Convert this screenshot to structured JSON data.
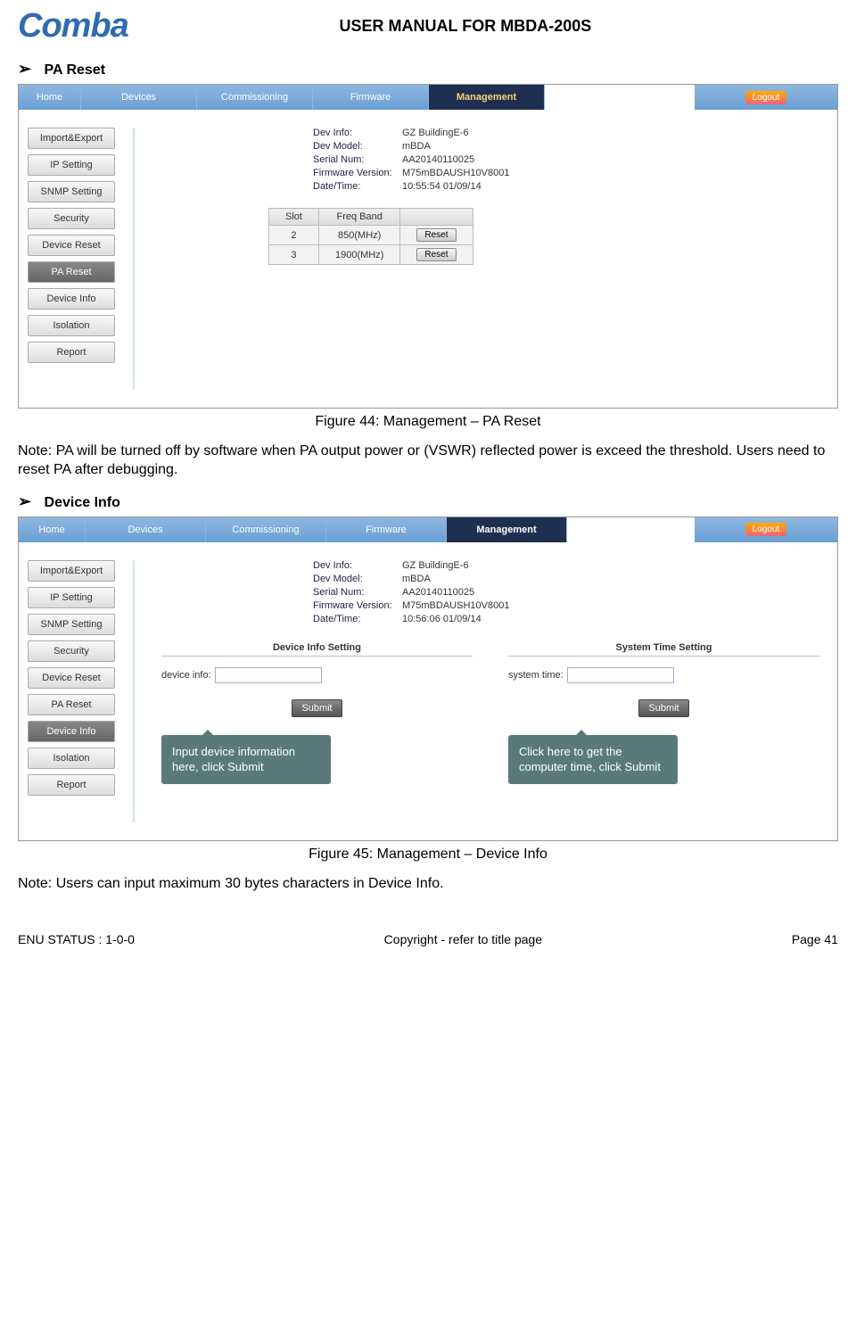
{
  "header": {
    "logo": "Comba",
    "title": "USER MANUAL FOR MBDA-200S"
  },
  "section1": {
    "title": "PA Reset"
  },
  "nav": {
    "items": [
      "Home",
      "Devices",
      "Commissioning",
      "Firmware",
      "Management"
    ],
    "logout": "Logout"
  },
  "sidebar": {
    "items": [
      "Import&Export",
      "IP Setting",
      "SNMP Setting",
      "Security",
      "Device Reset",
      "PA Reset",
      "Device Info",
      "Isolation",
      "Report"
    ]
  },
  "devinfo": {
    "rows": [
      {
        "label": "Dev Info:",
        "value": "GZ BuildingE-6"
      },
      {
        "label": "Dev Model:",
        "value": "mBDA"
      },
      {
        "label": "Serial Num:",
        "value": "AA20140110025"
      },
      {
        "label": "Firmware Version:",
        "value": "M75mBDAUSH10V8001"
      },
      {
        "label": "Date/Time:",
        "value": "10:55:54 01/09/14"
      }
    ]
  },
  "resetTable": {
    "headers": [
      "Slot",
      "Freq Band",
      ""
    ],
    "rows": [
      {
        "slot": "2",
        "freq": "850(MHz)",
        "btn": "Reset"
      },
      {
        "slot": "3",
        "freq": "1900(MHz)",
        "btn": "Reset"
      }
    ]
  },
  "caption1": "Figure 44: Management – PA Reset",
  "note1": "Note: PA will be turned off by software when PA output power or (VSWR) reflected power is exceed the threshold. Users need to reset PA after debugging.",
  "section2": {
    "title": "Device Info"
  },
  "devinfo2": {
    "rows": [
      {
        "label": "Dev Info:",
        "value": "GZ BuildingE-6"
      },
      {
        "label": "Dev Model:",
        "value": "mBDA"
      },
      {
        "label": "Serial Num:",
        "value": "AA20140110025"
      },
      {
        "label": "Firmware Version:",
        "value": "M75mBDAUSH10V8001"
      },
      {
        "label": "Date/Time:",
        "value": "10:56:06 01/09/14"
      }
    ]
  },
  "panels": {
    "left": {
      "title": "Device Info Setting",
      "label": "device info:",
      "submit": "Submit",
      "callout": "Input device information here, click Submit"
    },
    "right": {
      "title": "System Time Setting",
      "label": "system time:",
      "submit": "Submit",
      "callout": "Click here to get the computer time, click Submit"
    }
  },
  "caption2": "Figure 45: Management – Device Info",
  "note2": "Note: Users can input maximum 30 bytes characters in Device Info.",
  "footer": {
    "left": "ENU STATUS : 1-0-0",
    "center": "Copyright - refer to title page",
    "right": "Page 41"
  }
}
